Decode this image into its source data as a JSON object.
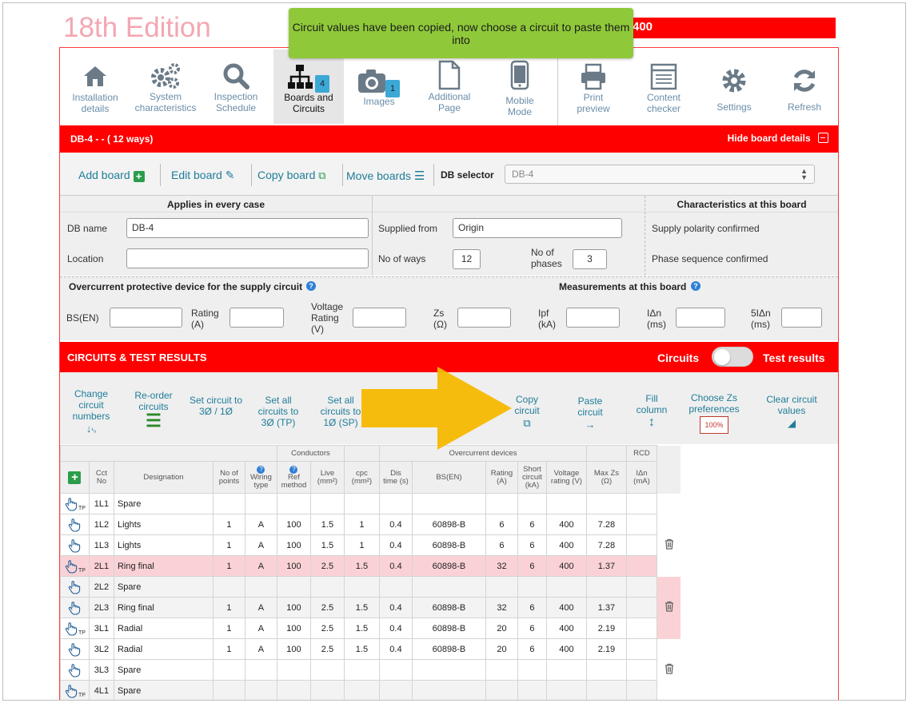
{
  "app": {
    "edition": "18th Edition",
    "title_fragment": "400"
  },
  "toast": {
    "message": "Circuit values have been copied, now choose a circuit to paste them into"
  },
  "toolbar": {
    "items": [
      {
        "label": "Installation details",
        "icon": "house-icon"
      },
      {
        "label": "System characteristics",
        "icon": "gears-icon"
      },
      {
        "label": "Inspection Schedule",
        "icon": "magnifier-icon"
      },
      {
        "label": "Boards and Circuits",
        "icon": "sitemap-icon",
        "badge": "4",
        "active": true
      },
      {
        "label": "Images",
        "icon": "camera-icon",
        "badge": "1"
      },
      {
        "label": "Additional Page",
        "icon": "page-icon"
      },
      {
        "label": "Mobile Mode",
        "icon": "mobile-icon"
      },
      {
        "label": "Print preview",
        "icon": "printer-icon"
      },
      {
        "label": "Content checker",
        "icon": "checklist-icon"
      },
      {
        "label": "Settings",
        "icon": "gear-icon"
      },
      {
        "label": "Refresh",
        "icon": "refresh-icon"
      }
    ]
  },
  "board": {
    "title": "DB-4 -  - ( 12 ways)",
    "hide_label": "Hide board details"
  },
  "board_actions": {
    "add": "Add board",
    "edit": "Edit board",
    "copy": "Copy board",
    "move": "Move boards",
    "selector_label": "DB selector",
    "selector_value": "DB-4"
  },
  "headers": {
    "every_case": "Applies in every case",
    "characteristics": "Characteristics at this board"
  },
  "fields": {
    "db_name_label": "DB name",
    "db_name": "DB-4",
    "location_label": "Location",
    "location": "",
    "supplied_from_label": "Supplied from",
    "supplied_from": "Origin",
    "ways_label": "No of ways",
    "ways": "12",
    "phases_label": "No of phases",
    "phases": "3",
    "polarity": "Supply polarity confirmed",
    "sequence": "Phase sequence confirmed"
  },
  "ocpd": {
    "title": "Overcurrent protective device for the supply circuit",
    "measurements": "Measurements at this board",
    "bs_label": "BS(EN)",
    "rating_label": "Rating (A)",
    "voltage_label": "Voltage Rating (V)",
    "zs_label": "Zs (Ω)",
    "ipf_label": "Ipf (kA)",
    "idn_label": "IΔn (ms)",
    "five_idn_label": "5IΔn (ms)"
  },
  "circuits": {
    "title": "CIRCUITS & TEST RESULTS",
    "circuits_label": "Circuits",
    "test_results_label": "Test results"
  },
  "tools": {
    "change": "Change circuit numbers",
    "reorder": "Re-order circuits",
    "set_circuit": "Set circuit to 3Ø / 1Ø",
    "set_all_3": "Set all circuits to 3Ø (TP)",
    "set_all_1": "Set all circuits to 1Ø (SP)",
    "copy": "Copy circuit",
    "paste": "Paste circuit",
    "fill": "Fill column",
    "choose_zs": "Choose Zs preferences",
    "zs_pct": "100%",
    "clear": "Clear circuit values"
  },
  "table": {
    "group_headers": {
      "conductors": "Conductors",
      "overcurrent": "Overcurrent devices",
      "rcd": "RCD"
    },
    "columns": [
      "Cct No",
      "Designation",
      "No of points",
      "Wiring type",
      "Ref method",
      "Live (mm²)",
      "cpc (mm²)",
      "Dis time (s)",
      "BS(EN)",
      "Rating (A)",
      "Short circuit (kA)",
      "Voltage rating (V)",
      "Max Zs (Ω)",
      "IΔn (mA)"
    ],
    "rows": [
      {
        "cct": "1L1",
        "designation": "Spare",
        "points": "",
        "wiring": "",
        "ref": "",
        "live": "",
        "cpc": "",
        "dis": "",
        "bsen": "",
        "rating": "",
        "short": "",
        "voltage": "",
        "maxzs": "",
        "idn": "",
        "tp": true,
        "style": "white"
      },
      {
        "cct": "1L2",
        "designation": "Lights",
        "points": "1",
        "wiring": "A",
        "ref": "100",
        "live": "1.5",
        "cpc": "1",
        "dis": "0.4",
        "bsen": "60898-B",
        "rating": "6",
        "short": "6",
        "voltage": "400",
        "maxzs": "7.28",
        "idn": "",
        "tp": false,
        "style": "white"
      },
      {
        "cct": "1L3",
        "designation": "Lights",
        "points": "1",
        "wiring": "A",
        "ref": "100",
        "live": "1.5",
        "cpc": "1",
        "dis": "0.4",
        "bsen": "60898-B",
        "rating": "6",
        "short": "6",
        "voltage": "400",
        "maxzs": "7.28",
        "idn": "",
        "tp": false,
        "style": "white"
      },
      {
        "cct": "2L1",
        "designation": "Ring final",
        "points": "1",
        "wiring": "A",
        "ref": "100",
        "live": "2.5",
        "cpc": "1.5",
        "dis": "0.4",
        "bsen": "60898-B",
        "rating": "32",
        "short": "6",
        "voltage": "400",
        "maxzs": "1.37",
        "idn": "",
        "tp": true,
        "style": "pink"
      },
      {
        "cct": "2L2",
        "designation": "Spare",
        "points": "",
        "wiring": "",
        "ref": "",
        "live": "",
        "cpc": "",
        "dis": "",
        "bsen": "",
        "rating": "",
        "short": "",
        "voltage": "",
        "maxzs": "",
        "idn": "",
        "tp": false,
        "style": "grey"
      },
      {
        "cct": "2L3",
        "designation": "Ring final",
        "points": "1",
        "wiring": "A",
        "ref": "100",
        "live": "2.5",
        "cpc": "1.5",
        "dis": "0.4",
        "bsen": "60898-B",
        "rating": "32",
        "short": "6",
        "voltage": "400",
        "maxzs": "1.37",
        "idn": "",
        "tp": false,
        "style": "grey"
      },
      {
        "cct": "3L1",
        "designation": "Radial",
        "points": "1",
        "wiring": "A",
        "ref": "100",
        "live": "2.5",
        "cpc": "1.5",
        "dis": "0.4",
        "bsen": "60898-B",
        "rating": "20",
        "short": "6",
        "voltage": "400",
        "maxzs": "2.19",
        "idn": "",
        "tp": true,
        "style": "white"
      },
      {
        "cct": "3L2",
        "designation": "Radial",
        "points": "1",
        "wiring": "A",
        "ref": "100",
        "live": "2.5",
        "cpc": "1.5",
        "dis": "0.4",
        "bsen": "60898-B",
        "rating": "20",
        "short": "6",
        "voltage": "400",
        "maxzs": "2.19",
        "idn": "",
        "tp": false,
        "style": "white"
      },
      {
        "cct": "3L3",
        "designation": "Spare",
        "points": "",
        "wiring": "",
        "ref": "",
        "live": "",
        "cpc": "",
        "dis": "",
        "bsen": "",
        "rating": "",
        "short": "",
        "voltage": "",
        "maxzs": "",
        "idn": "",
        "tp": false,
        "style": "white"
      },
      {
        "cct": "4L1",
        "designation": "Spare",
        "points": "",
        "wiring": "",
        "ref": "",
        "live": "",
        "cpc": "",
        "dis": "",
        "bsen": "",
        "rating": "",
        "short": "",
        "voltage": "",
        "maxzs": "",
        "idn": "",
        "tp": true,
        "style": "grey"
      }
    ]
  },
  "colors": {
    "brand_red": "#ff0000",
    "accent_teal": "#1f7d99",
    "toast_green": "#8fc93a",
    "arrow_orange": "#f5b800",
    "row_pink": "#fad2d6"
  }
}
